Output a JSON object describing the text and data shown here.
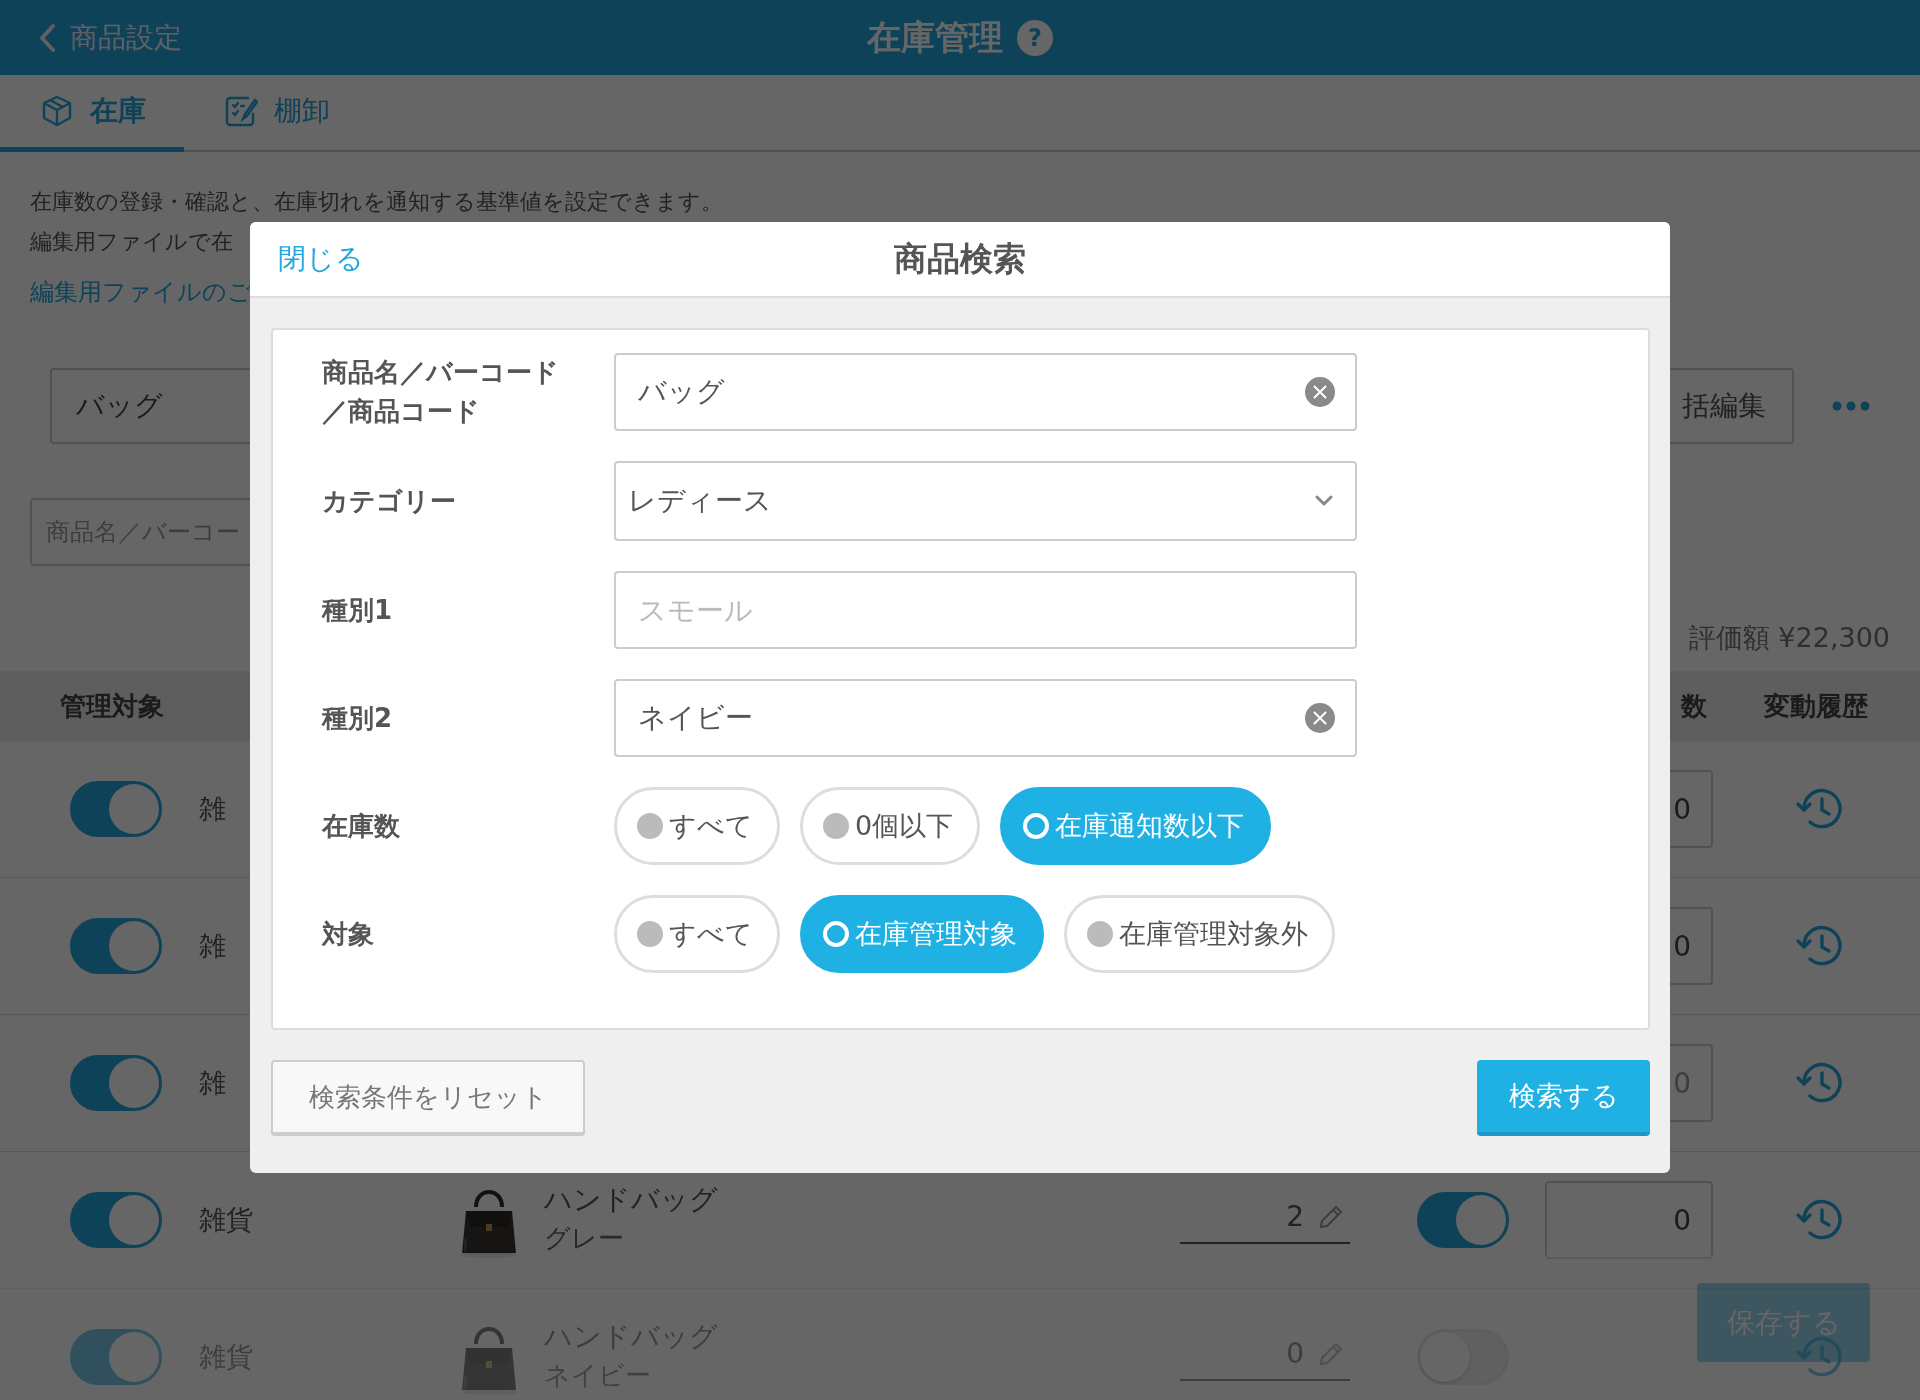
{
  "header": {
    "back_label": "商品設定",
    "title": "在庫管理",
    "help": "?"
  },
  "tabs": [
    {
      "label": "在庫",
      "selected": true
    },
    {
      "label": "棚卸",
      "selected": false
    }
  ],
  "description": [
    "在庫数の登録・確認と、在庫切れを通知する基準値を設定できます。",
    "編集用ファイルで在"
  ],
  "file_link": "編集用ファイルのご",
  "search_value": "バッグ",
  "bulk_edit_button": "括編集",
  "filter_placeholder": "商品名／バーコー",
  "valuation": "評価額 ¥22,300",
  "table": {
    "columns": [
      "管理対象",
      "数",
      "変動履歴"
    ],
    "rows": [
      {
        "managed": true,
        "category": "雑",
        "stock_input": "0",
        "input_disabled": false
      },
      {
        "managed": true,
        "category": "雑",
        "stock_input": "0",
        "input_disabled": false
      },
      {
        "managed": true,
        "category": "雑",
        "stock_input": "0",
        "input_disabled": true
      },
      {
        "managed": true,
        "category": "雑貨",
        "product_name": "ハンドバッグ",
        "variant": "グレー",
        "quantity": "2",
        "notify": true,
        "stock_input": "0",
        "input_disabled": false
      },
      {
        "managed": true,
        "category": "雑貨",
        "product_name": "ハンドバッグ",
        "variant": "ネイビー",
        "quantity": "0",
        "notify": false
      }
    ]
  },
  "save_button": {
    "label": "保存する",
    "disabled": true
  },
  "modal": {
    "close_label": "閉じる",
    "title": "商品検索",
    "fields": [
      {
        "kind": "text",
        "label": "商品名／バーコード／商品コード",
        "value": "バッグ",
        "clearable": true
      },
      {
        "kind": "select",
        "label": "カテゴリー",
        "value": "レディース"
      },
      {
        "kind": "text",
        "label": "種別1",
        "placeholder": "スモール",
        "clearable": false
      },
      {
        "kind": "text",
        "label": "種別2",
        "value": "ネイビー",
        "clearable": true
      },
      {
        "kind": "choices",
        "label": "在庫数",
        "options": [
          {
            "label": "すべて",
            "selected": false
          },
          {
            "label": "0個以下",
            "selected": false
          },
          {
            "label": "在庫通知数以下",
            "selected": true
          }
        ]
      },
      {
        "kind": "choices",
        "label": "対象",
        "options": [
          {
            "label": "すべて",
            "selected": false
          },
          {
            "label": "在庫管理対象",
            "selected": true
          },
          {
            "label": "在庫管理対象外",
            "selected": false
          }
        ]
      }
    ],
    "reset_button": "検索条件をリセット",
    "search_button": "検索する"
  }
}
